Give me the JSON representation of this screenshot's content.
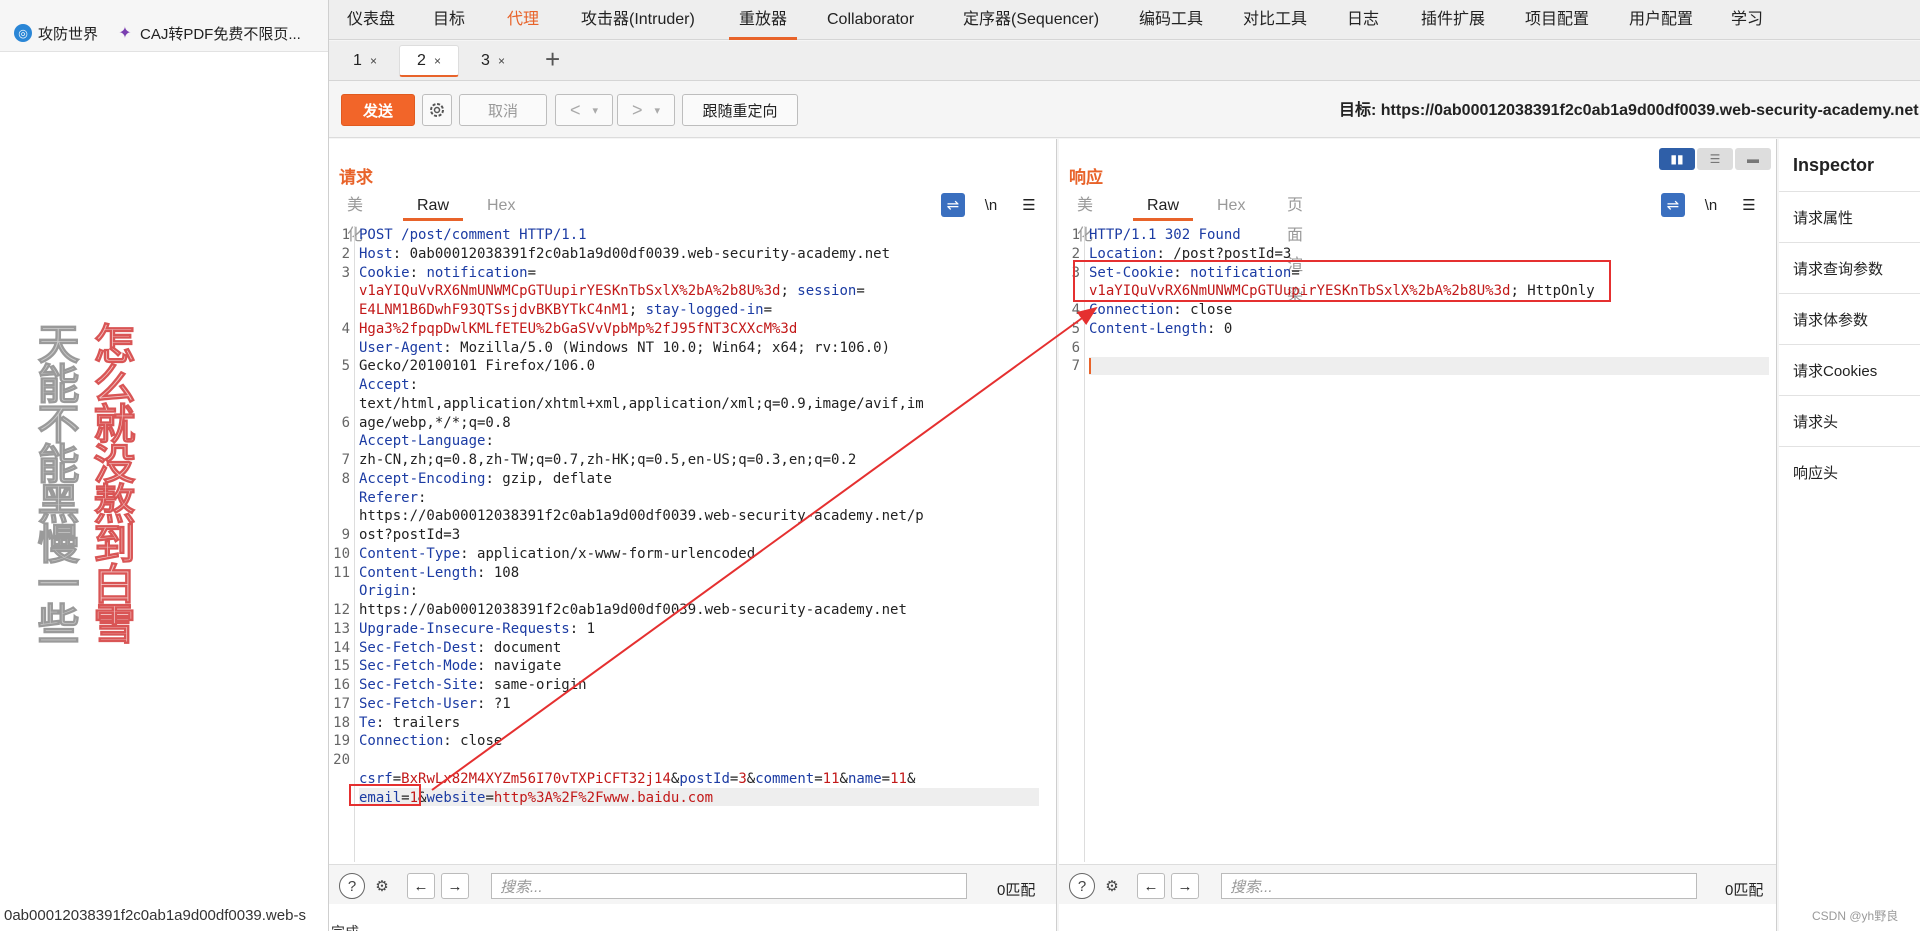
{
  "browser": {
    "bookmarks": [
      {
        "label": "攻防世界",
        "icon": "globe-icon"
      },
      {
        "label": "CAJ转PDF免费不限页...",
        "icon": "feather-icon"
      }
    ],
    "status_url": "0ab00012038391f2c0ab1a9d00df0039.web-s",
    "poem_left": "天能不能黑慢一些",
    "poem_right": "怎么就没熬到白雪"
  },
  "menu": {
    "items": [
      "仪表盘",
      "目标",
      "代理",
      "攻击器(Intruder)",
      "重放器",
      "Collaborator",
      "定序器(Sequencer)",
      "编码工具",
      "对比工具",
      "日志",
      "插件扩展",
      "项目配置",
      "用户配置",
      "学习"
    ],
    "active": "重放器"
  },
  "tabs": {
    "items": [
      {
        "label": "1",
        "close": "×"
      },
      {
        "label": "2",
        "close": "×"
      },
      {
        "label": "3",
        "close": "×"
      }
    ],
    "add": "+"
  },
  "toolbar": {
    "send": "发送",
    "cancel": "取消",
    "back": "<",
    "forward": ">",
    "dropdown": "▾",
    "follow_redirect": "跟随重定向",
    "target": "目标: https://0ab00012038391f2c0ab1a9d00df0039.web-security-academy.net"
  },
  "request": {
    "title": "请求",
    "tabs": [
      "美化",
      "Raw",
      "Hex"
    ],
    "active_tab": "Raw",
    "icons": [
      "wrap-icon",
      "newline-icon",
      "menu-icon"
    ],
    "newline_label": "\\n",
    "line_numbers": [
      "1",
      "2",
      "3",
      "",
      "",
      "4",
      "",
      "5",
      "",
      "",
      "6",
      "",
      "7",
      "8",
      "",
      "",
      "9",
      "10",
      "11",
      "",
      "12",
      "13",
      "14",
      "15",
      "16",
      "17",
      "18",
      "19",
      "20",
      ""
    ],
    "search_placeholder": "搜索...",
    "match_count": "0匹配"
  },
  "response": {
    "title": "响应",
    "tabs": [
      "美化",
      "Raw",
      "Hex",
      "页面渲染"
    ],
    "active_tab": "Raw",
    "newline_label": "\\n",
    "line_numbers": [
      "1",
      "2",
      "3",
      "",
      "4",
      "5",
      "6",
      "7"
    ],
    "search_placeholder": "搜索...",
    "match_count": "0匹配"
  },
  "inspector": {
    "title": "Inspector",
    "items": [
      "请求属性",
      "请求查询参数",
      "请求体参数",
      "请求Cookies",
      "请求头",
      "响应头"
    ]
  },
  "footer": {
    "status": "完成",
    "watermark": "CSDN @yh野良"
  }
}
